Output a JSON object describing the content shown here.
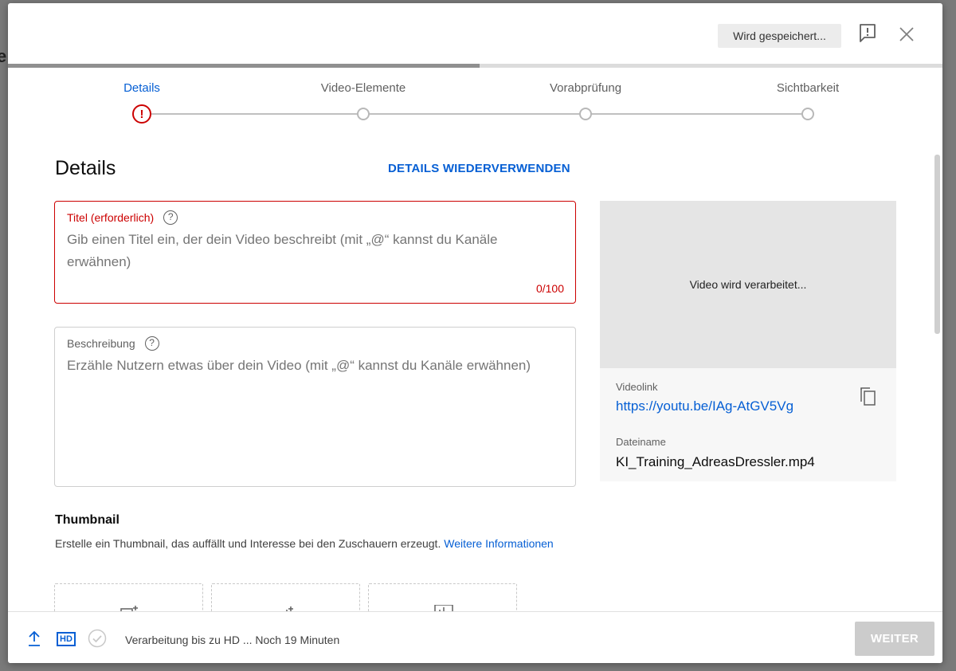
{
  "backdrop": {
    "partial_text": "e"
  },
  "header": {
    "saving_status": "Wird gespeichert...",
    "feedback_icon": "feedback-icon",
    "close_icon": "close-icon"
  },
  "upload_progress": {
    "fraction": 0.505
  },
  "stepper": {
    "steps": [
      {
        "label": "Details",
        "state": "error"
      },
      {
        "label": "Video-Elemente",
        "state": "pending"
      },
      {
        "label": "Vorabprüfung",
        "state": "pending"
      },
      {
        "label": "Sichtbarkeit",
        "state": "pending"
      }
    ]
  },
  "details": {
    "title": "Details",
    "reuse_label": "DETAILS WIEDERVERWENDEN",
    "title_field": {
      "label": "Titel (erforderlich)",
      "placeholder": "Gib einen Titel ein, der dein Video beschreibt (mit „@“ kannst du Kanäle erwähnen)",
      "value": "",
      "counter": "0/100"
    },
    "description_field": {
      "label": "Beschreibung",
      "placeholder": "Erzähle Nutzern etwas über dein Video (mit „@“ kannst du Kanäle erwähnen)",
      "value": ""
    },
    "thumbnail": {
      "title": "Thumbnail",
      "description": "Erstelle ein Thumbnail, das auffällt und Interesse bei den Zuschauern erzeugt.",
      "link": "Weitere Informationen"
    }
  },
  "preview": {
    "processing_text": "Video wird verarbeitet...",
    "video_link_label": "Videolink",
    "video_link": "https://youtu.be/IAg-AtGV5Vg",
    "filename_label": "Dateiname",
    "filename": "KI_Training_AdreasDressler.mp4"
  },
  "footer": {
    "hd_badge": "HD",
    "status": "Verarbeitung bis zu HD ... Noch 19 Minuten",
    "next_label": "WEITER"
  },
  "colors": {
    "accent": "#065fd4",
    "error": "#cc0000",
    "disabled_button": "#cccccc"
  }
}
